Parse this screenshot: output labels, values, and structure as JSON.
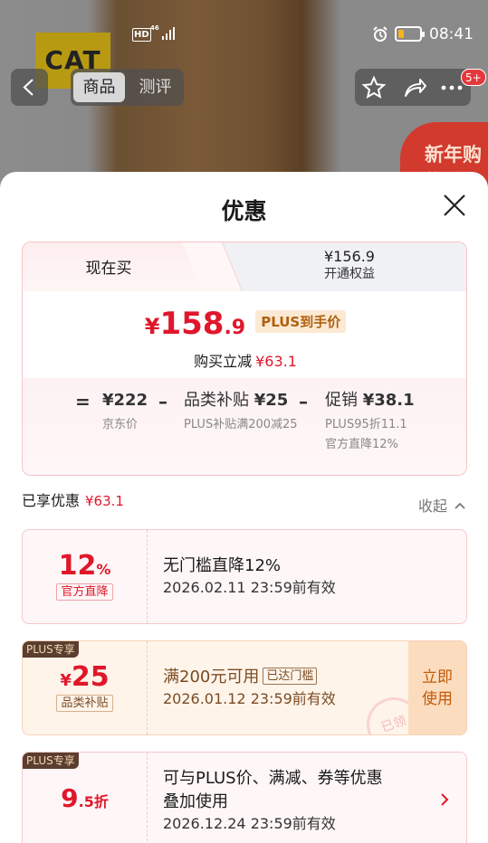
{
  "status_bar": {
    "hd": "HD",
    "network": "46",
    "time": "08:41",
    "battery_level": 0.15
  },
  "background": {
    "brand_logo": "CAT",
    "promo_badge": "新年购物季"
  },
  "top_nav": {
    "tabs": [
      {
        "label": "商品",
        "active": true
      },
      {
        "label": "测评",
        "active": false
      }
    ],
    "badge_count": "5+",
    "icons": [
      "back-chevron-icon",
      "star-icon",
      "share-icon",
      "more-icon"
    ]
  },
  "sheet": {
    "title": "优惠",
    "price_tabs": {
      "now": "现在买",
      "plus_price": "¥156.9",
      "plus_sub": "开通权益"
    },
    "final_price": {
      "currency": "¥",
      "integer": "158",
      "decimal": ".9",
      "tag": "PLUS到手价"
    },
    "save": {
      "label": "购买立减",
      "amount": "¥63.1"
    },
    "breakdown": {
      "equals": "=",
      "minus": "–",
      "items": [
        {
          "value_prefix": "",
          "value": "¥222",
          "desc": "京东价"
        },
        {
          "value_prefix": "品类补贴 ",
          "value": "¥25",
          "desc": "PLUS补贴满200减25"
        },
        {
          "value_prefix": "促销 ",
          "value": "¥38.1",
          "desc_lines": [
            "PLUS95折11.1",
            "官方直降12%"
          ]
        }
      ]
    },
    "enjoyed": {
      "label": "已享优惠",
      "amount": "¥63.1",
      "collapse": "收起"
    },
    "coupons": [
      {
        "big": "12",
        "unit": "%",
        "label": "官方直降",
        "title": "无门槛直降12%",
        "expiry": "2026.02.11 23:59前有效"
      },
      {
        "corner": "PLUS专享",
        "currency": "¥",
        "big": "25",
        "label": "品类补贴",
        "title": "满200元可用",
        "tag": "已达门槛",
        "expiry": "2026.01.12 23:59前有效",
        "action": "立即使用",
        "stamp": "已领"
      },
      {
        "corner": "PLUS专享",
        "big": "9",
        "unit": ".5折",
        "title_lines": [
          "可与PLUS价、满减、券等优惠",
          "叠加使用"
        ],
        "expiry": "2026.12.24 23:59前有效"
      }
    ]
  }
}
